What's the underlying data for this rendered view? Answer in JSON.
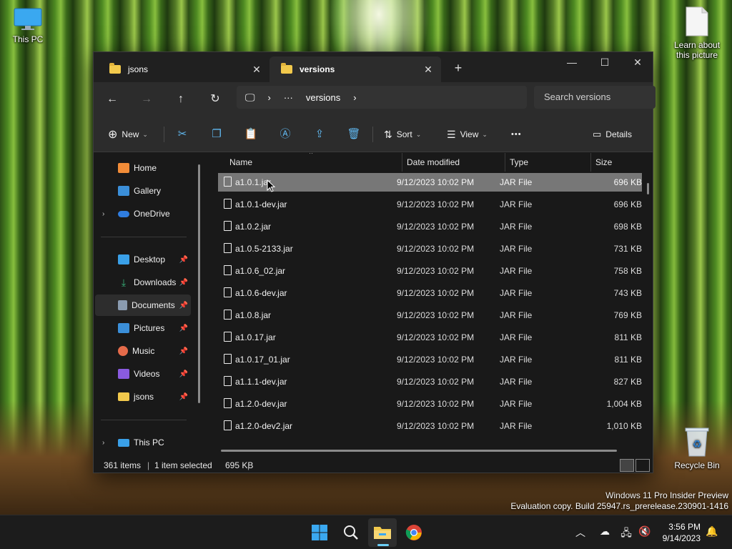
{
  "desktop": {
    "icons": {
      "this_pc": "This PC",
      "learn": "Learn about this picture",
      "recycle": "Recycle Bin"
    },
    "watermark": {
      "line1": "Windows 11 Pro Insider Preview",
      "line2": "Evaluation copy. Build 25947.rs_prerelease.230901-1416"
    }
  },
  "explorer": {
    "tabs": [
      {
        "label": "jsons",
        "active": false
      },
      {
        "label": "versions",
        "active": true
      }
    ],
    "new_tab_icon": "plus-icon",
    "caption": {
      "minimize": "—",
      "maximize": "☐",
      "close": "✕"
    },
    "address": {
      "ellipsis": "···",
      "current": "versions"
    },
    "search": {
      "placeholder": "Search versions"
    },
    "commands": {
      "new": "New",
      "sort": "Sort",
      "view": "View",
      "more": "•••",
      "details": "Details"
    },
    "sidebar": {
      "items": [
        {
          "label": "Home",
          "icon": "home-icon",
          "color": "#f28c38"
        },
        {
          "label": "Gallery",
          "icon": "gallery-icon",
          "color": "#3b8fd9"
        },
        {
          "label": "OneDrive",
          "icon": "cloud-icon",
          "color": "#2f7de0"
        },
        {
          "label": "Desktop",
          "icon": "desktop-icon",
          "color": "#3aa0e8"
        },
        {
          "label": "Downloads",
          "icon": "download-icon",
          "color": "#38b27a"
        },
        {
          "label": "Documents",
          "icon": "document-icon",
          "color": "#8a9bb0"
        },
        {
          "label": "Pictures",
          "icon": "pictures-icon",
          "color": "#3b8fd9"
        },
        {
          "label": "Music",
          "icon": "music-icon",
          "color": "#e56b4a"
        },
        {
          "label": "Videos",
          "icon": "videos-icon",
          "color": "#8a5be0"
        },
        {
          "label": "jsons",
          "icon": "folder-icon",
          "color": "#f2c94c"
        },
        {
          "label": "This PC",
          "icon": "computer-icon",
          "color": "#3aa0e8"
        }
      ]
    },
    "columns": {
      "name": "Name",
      "date": "Date modified",
      "type": "Type",
      "size": "Size"
    },
    "files": [
      {
        "name": "a1.0.1.jar",
        "date": "9/12/2023 10:02 PM",
        "type": "JAR File",
        "size": "696 KB",
        "selected": true
      },
      {
        "name": "a1.0.1-dev.jar",
        "date": "9/12/2023 10:02 PM",
        "type": "JAR File",
        "size": "696 KB"
      },
      {
        "name": "a1.0.2.jar",
        "date": "9/12/2023 10:02 PM",
        "type": "JAR File",
        "size": "698 KB"
      },
      {
        "name": "a1.0.5-2133.jar",
        "date": "9/12/2023 10:02 PM",
        "type": "JAR File",
        "size": "731 KB"
      },
      {
        "name": "a1.0.6_02.jar",
        "date": "9/12/2023 10:02 PM",
        "type": "JAR File",
        "size": "758 KB"
      },
      {
        "name": "a1.0.6-dev.jar",
        "date": "9/12/2023 10:02 PM",
        "type": "JAR File",
        "size": "743 KB"
      },
      {
        "name": "a1.0.8.jar",
        "date": "9/12/2023 10:02 PM",
        "type": "JAR File",
        "size": "769 KB"
      },
      {
        "name": "a1.0.17.jar",
        "date": "9/12/2023 10:02 PM",
        "type": "JAR File",
        "size": "811 KB"
      },
      {
        "name": "a1.0.17_01.jar",
        "date": "9/12/2023 10:02 PM",
        "type": "JAR File",
        "size": "811 KB"
      },
      {
        "name": "a1.1.1-dev.jar",
        "date": "9/12/2023 10:02 PM",
        "type": "JAR File",
        "size": "827 KB"
      },
      {
        "name": "a1.2.0-dev.jar",
        "date": "9/12/2023 10:02 PM",
        "type": "JAR File",
        "size": "1,004 KB"
      },
      {
        "name": "a1.2.0-dev2.jar",
        "date": "9/12/2023 10:02 PM",
        "type": "JAR File",
        "size": "1,010 KB"
      }
    ],
    "status": {
      "count": "361 items",
      "selected": "1 item selected",
      "size": "695 KB"
    }
  },
  "taskbar": {
    "apps": [
      {
        "name": "start-button",
        "icon": "windows-logo-icon"
      },
      {
        "name": "search-button",
        "icon": "search-icon"
      },
      {
        "name": "file-explorer-button",
        "icon": "folder-icon",
        "active": true
      },
      {
        "name": "chrome-button",
        "icon": "chrome-icon"
      }
    ],
    "clock": {
      "time": "3:56 PM",
      "date": "9/14/2023"
    }
  }
}
